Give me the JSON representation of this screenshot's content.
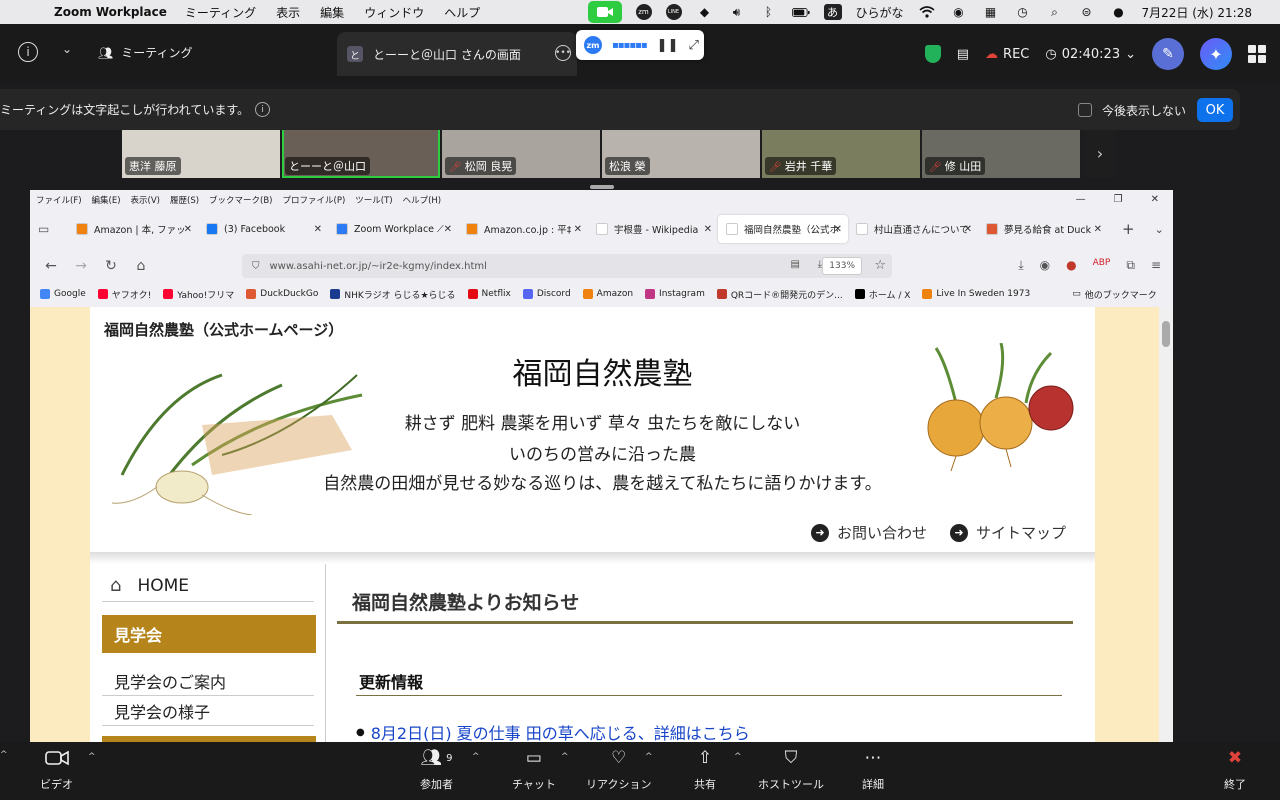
{
  "menubar": {
    "app_name": "Zoom Workplace",
    "items": [
      "ミーティング",
      "表示",
      "編集",
      "ウィンドウ",
      "ヘルプ"
    ],
    "ime_char": "あ",
    "ime_mode": "ひらがな",
    "datetime": "7月22日 (水)  21:28",
    "zm_label": "zm",
    "line_label": "LINE"
  },
  "zoom_top": {
    "meeting_label": "ミーティング",
    "share_tab_chip": "と",
    "share_tab_title": "とーーと＠山口 さんの画面",
    "rec_label": "REC",
    "timer": "02:40:23",
    "float_logo": "zm"
  },
  "banner": {
    "text": "ミーティングは文字起こしが行われています。",
    "checkbox_label": "今後表示しない",
    "ok_label": "OK"
  },
  "participants": [
    {
      "name": "恵洋 藤原",
      "muted": false
    },
    {
      "name": "とーーと＠山口",
      "muted": false,
      "active": true
    },
    {
      "name": "松岡 良晃",
      "muted": true
    },
    {
      "name": "松浪 榮",
      "muted": false
    },
    {
      "name": "岩井 千華",
      "muted": true
    },
    {
      "name": "修 山田",
      "muted": true
    }
  ],
  "browser": {
    "menu": [
      "ファイル(F)",
      "編集(E)",
      "表示(V)",
      "履歴(S)",
      "ブックマーク(B)",
      "プロファイル(P)",
      "ツール(T)",
      "ヘルプ(H)"
    ],
    "tabs": [
      {
        "title": "Amazon | 本, ファッ",
        "fav_color": "#f0820f"
      },
      {
        "title": "(3) Facebook",
        "fav_color": "#1877f2"
      },
      {
        "title": "Zoom Workplace ⟋",
        "fav_color": "#2d7bf4"
      },
      {
        "title": "Amazon.co.jp : 平‡",
        "fav_color": "#f0820f"
      },
      {
        "title": "宇根豊 - Wikipedia",
        "fav_color": "#ffffff"
      },
      {
        "title": "福岡自然農塾（公式ホ",
        "fav_color": "#ffffff",
        "active": true
      },
      {
        "title": "村山直通さんについて｜",
        "fav_color": "#ffffff"
      },
      {
        "title": "夢見る給食 at Duck",
        "fav_color": "#de5833"
      }
    ],
    "url": "www.asahi-net.or.jp/~ir2e-kgmy/index.html",
    "zoom": "133%",
    "bookmarks": [
      "Google",
      "ヤフオク!",
      "Yahoo!フリマ",
      "DuckDuckGo",
      "NHKラジオ らじる★らじる",
      "Netflix",
      "Discord",
      "Amazon",
      "Instagram",
      "QRコード®開発元のデン...",
      "ホーム / X",
      "Live In Sweden 1973"
    ],
    "other_bookmarks": "他のブックマーク"
  },
  "site": {
    "corner_title": "福岡自然農塾（公式ホームページ）",
    "title": "福岡自然農塾",
    "tagline1": "耕さず 肥料 農薬を用いず 草々 虫たちを敵にしない",
    "tagline2": "いのちの営みに沿った農",
    "tagline3": "自然農の田畑が見せる妙なる巡りは、農を越えて私たちに語りかけます。",
    "contact": "お問い合わせ",
    "sitemap": "サイトマップ",
    "nav_home": "HOME",
    "nav_section": "見学会",
    "nav_links": [
      "見学会のご案内",
      "見学会の様子"
    ],
    "heading": "福岡自然農塾よりお知らせ",
    "updates_heading": "更新情報",
    "news_item": "8月2日(日) 夏の仕事 田の草へ応じる、詳細はこちら"
  },
  "zoom_bottom": {
    "video": "ビデオ",
    "participants": "参加者",
    "participant_count": "9",
    "chat": "チャット",
    "reactions": "リアクション",
    "share": "共有",
    "host_tools": "ホストツール",
    "more": "詳細",
    "end": "終了"
  },
  "colors": {
    "accent_green": "#2ecc40",
    "zoom_blue": "#0e72ed",
    "nav_gold": "#b5841a",
    "page_bg": "#fcebc1",
    "end_red": "#e0433a"
  }
}
